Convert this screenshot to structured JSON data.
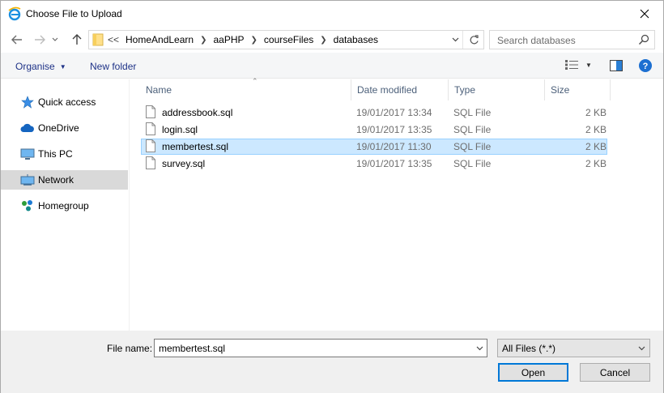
{
  "window": {
    "title": "Choose File to Upload"
  },
  "address": {
    "overflow": "<<",
    "crumbs": [
      "HomeAndLearn",
      "aaPHP",
      "courseFiles",
      "databases"
    ]
  },
  "search": {
    "placeholder": "Search databases"
  },
  "toolbar": {
    "organise_label": "Organise",
    "new_folder_label": "New folder"
  },
  "nav": {
    "items": [
      {
        "label": "Quick access",
        "icon": "star-icon"
      },
      {
        "label": "OneDrive",
        "icon": "cloud-icon"
      },
      {
        "label": "This PC",
        "icon": "computer-icon"
      },
      {
        "label": "Network",
        "icon": "network-icon",
        "selected": true
      },
      {
        "label": "Homegroup",
        "icon": "homegroup-icon"
      }
    ]
  },
  "columns": {
    "name": "Name",
    "date": "Date modified",
    "type": "Type",
    "size": "Size"
  },
  "files": [
    {
      "name": "addressbook.sql",
      "date": "19/01/2017 13:34",
      "type": "SQL File",
      "size": "2 KB"
    },
    {
      "name": "login.sql",
      "date": "19/01/2017 13:35",
      "type": "SQL File",
      "size": "2 KB"
    },
    {
      "name": "membertest.sql",
      "date": "19/01/2017 11:30",
      "type": "SQL File",
      "size": "2 KB",
      "selected": true
    },
    {
      "name": "survey.sql",
      "date": "19/01/2017 13:35",
      "type": "SQL File",
      "size": "2 KB"
    }
  ],
  "bottom": {
    "file_name_label": "File name:",
    "file_name_value": "membertest.sql",
    "file_type_value": "All Files (*.*)",
    "open_label": "Open",
    "cancel_label": "Cancel"
  },
  "colors": {
    "selection_bg": "#cce8ff",
    "selection_border": "#99d1ff",
    "link_blue": "#1e3287",
    "accent": "#0078d7"
  }
}
